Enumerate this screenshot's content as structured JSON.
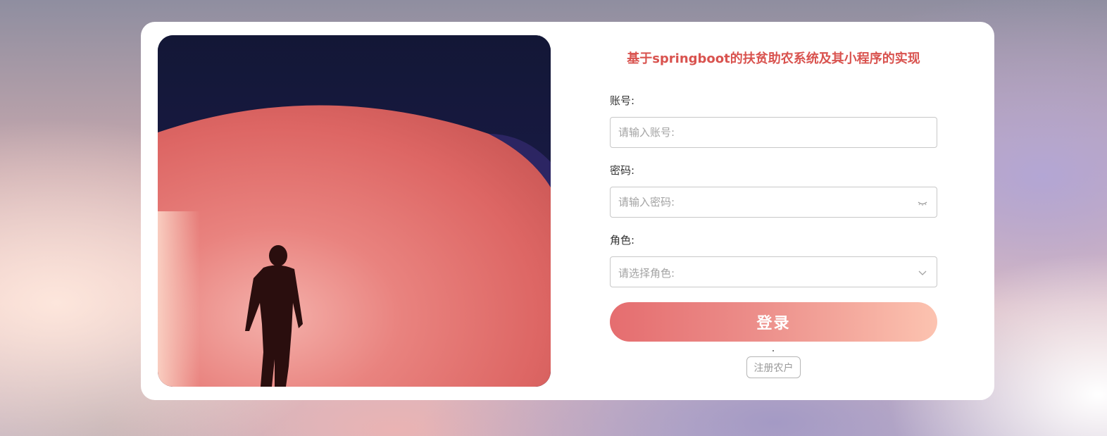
{
  "title": "基于springboot的扶贫助农系统及其小程序的实现",
  "account": {
    "label": "账号:",
    "placeholder": "请输入账号:",
    "value": ""
  },
  "password": {
    "label": "密码:",
    "placeholder": "请输入密码:",
    "value": "",
    "suffix_icon": "eye-closed-icon"
  },
  "role": {
    "label": "角色:",
    "placeholder": "请选择角色:",
    "suffix_icon": "chevron-down-icon"
  },
  "login_label": "登录",
  "register_label": "注册农户",
  "colors": {
    "title": "#d9534f",
    "button_start": "#e56d6f",
    "button_end": "#fcc3b0"
  }
}
